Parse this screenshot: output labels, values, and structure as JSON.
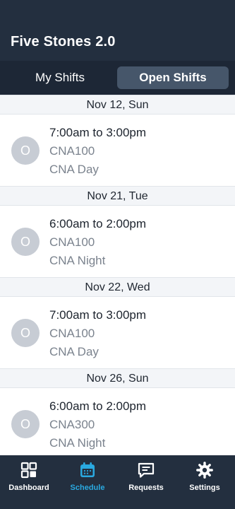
{
  "header": {
    "title": "Five Stones 2.0"
  },
  "tabs": [
    {
      "label": "My Shifts",
      "active": false
    },
    {
      "label": "Open Shifts",
      "active": true
    }
  ],
  "groups": [
    {
      "date": "Nov 12, Sun",
      "shift": {
        "avatar": "O",
        "time": "7:00am to 3:00pm",
        "code": "CNA100",
        "type": "CNA Day"
      }
    },
    {
      "date": "Nov 21, Tue",
      "shift": {
        "avatar": "O",
        "time": "6:00am to 2:00pm",
        "code": "CNA100",
        "type": "CNA Night"
      }
    },
    {
      "date": "Nov 22, Wed",
      "shift": {
        "avatar": "O",
        "time": "7:00am to 3:00pm",
        "code": "CNA100",
        "type": "CNA Day"
      }
    },
    {
      "date": "Nov 26, Sun",
      "shift": {
        "avatar": "O",
        "time": "6:00am to 2:00pm",
        "code": "CNA300",
        "type": "CNA Night"
      }
    }
  ],
  "nav": [
    {
      "label": "Dashboard",
      "icon": "dashboard-icon",
      "active": false
    },
    {
      "label": "Schedule",
      "icon": "calendar-icon",
      "active": true
    },
    {
      "label": "Requests",
      "icon": "chat-icon",
      "active": false
    },
    {
      "label": "Settings",
      "icon": "gear-icon",
      "active": false
    }
  ],
  "colors": {
    "header_bg": "#232f3f",
    "tab_active_bg": "#46566a",
    "accent": "#2aa9e0",
    "avatar_bg": "#c7ccd4"
  }
}
